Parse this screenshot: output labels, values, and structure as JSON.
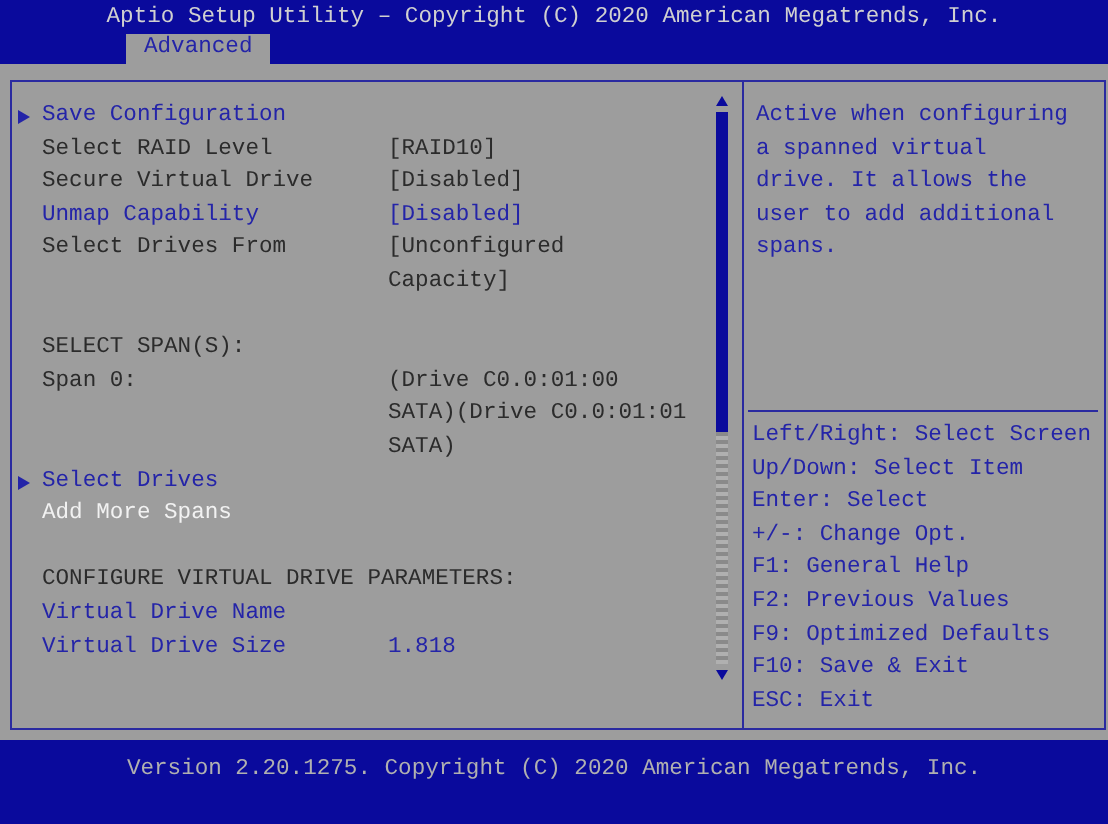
{
  "header": {
    "title": "Aptio Setup Utility – Copyright (C) 2020 American Megatrends, Inc.",
    "tabs": [
      {
        "label": "Advanced",
        "selected": true
      }
    ]
  },
  "items": [
    {
      "kind": "submenu",
      "label": "Save Configuration",
      "selected": false,
      "disabled": false
    },
    {
      "kind": "setting",
      "label": "Select RAID Level",
      "value": "[RAID10]",
      "selected": false,
      "disabled": true
    },
    {
      "kind": "setting",
      "label": "Secure Virtual Drive",
      "value": "[Disabled]",
      "selected": false,
      "disabled": true
    },
    {
      "kind": "setting",
      "label": "Unmap Capability",
      "value": "[Disabled]",
      "selected": false,
      "disabled": false
    },
    {
      "kind": "setting",
      "label": "Select Drives From",
      "value": "[Unconfigured Capacity]",
      "selected": false,
      "disabled": true
    },
    {
      "kind": "gap"
    },
    {
      "kind": "heading",
      "label": "SELECT SPAN(S):"
    },
    {
      "kind": "info",
      "label": "Span 0:",
      "value": "(Drive C0.0:01:00 SATA)(Drive C0.0:01:01 SATA)"
    },
    {
      "kind": "submenu",
      "label": "Select Drives",
      "selected": false,
      "disabled": false
    },
    {
      "kind": "action",
      "label": "Add More Spans",
      "selected": true,
      "disabled": false
    },
    {
      "kind": "gap"
    },
    {
      "kind": "heading",
      "label": "CONFIGURE VIRTUAL DRIVE PARAMETERS:"
    },
    {
      "kind": "setting",
      "label": "Virtual Drive Name",
      "selected": false,
      "disabled": false
    },
    {
      "kind": "setting",
      "label": "Virtual Drive Size",
      "value": "1.818",
      "selected": false,
      "disabled": false
    }
  ],
  "help": {
    "text": "Active when configuring a spanned virtual drive. It allows the user to add additional spans.",
    "keys": [
      "Left/Right: Select Screen",
      "Up/Down: Select Item",
      "Enter: Select",
      "+/-: Change Opt.",
      "F1: General Help",
      "F2: Previous Values",
      "F9: Optimized Defaults",
      "F10: Save & Exit",
      "ESC: Exit"
    ]
  },
  "footer": {
    "version": "Version 2.20.1275. Copyright (C) 2020 American Megatrends, Inc."
  }
}
